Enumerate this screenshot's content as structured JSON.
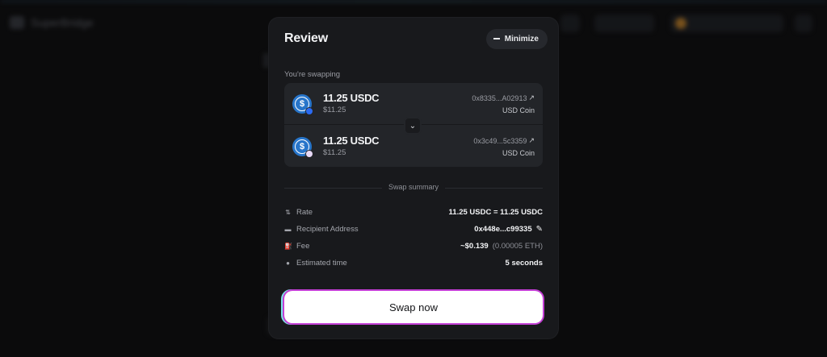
{
  "background": {
    "app_name": "SuperBridge",
    "chip_label_1": "Bridge",
    "chip_label_2": "0x448e...c99335"
  },
  "modal": {
    "title": "Review",
    "minimize_label": "Minimize",
    "section_label": "You're swapping",
    "from": {
      "amount": "11.25 USDC",
      "usd": "$11.25",
      "address": "0x8335...A02913",
      "coin_name": "USD Coin"
    },
    "to": {
      "amount": "11.25 USDC",
      "usd": "$11.25",
      "address": "0x3c49...5c3359",
      "coin_name": "USD Coin"
    },
    "summary_label": "Swap summary",
    "summary": {
      "rate_label": "Rate",
      "rate_value": "11.25 USDC = 11.25 USDC",
      "recipient_label": "Recipient Address",
      "recipient_value": "0x448e...c99335",
      "fee_label": "Fee",
      "fee_value": "~$0.139",
      "fee_eth": "(0.00005 ETH)",
      "time_label": "Estimated time",
      "time_value": "5 seconds"
    },
    "swap_button_label": "Swap now"
  },
  "colors": {
    "modal_bg": "#18191c",
    "card_bg": "#232529",
    "usdc_blue": "#2775ca",
    "button_bg": "#ffffff",
    "button_glow_magenta": "#c43fd6",
    "button_glow_cyan": "#7be2e6"
  },
  "icons": {
    "rate": "arrows-updown-icon",
    "recipient": "wallet-icon",
    "fee": "gas-pump-icon",
    "time": "clock-icon",
    "edit": "pencil-icon",
    "swap_toggle": "chevron-down-icon",
    "external": "external-link-icon"
  }
}
